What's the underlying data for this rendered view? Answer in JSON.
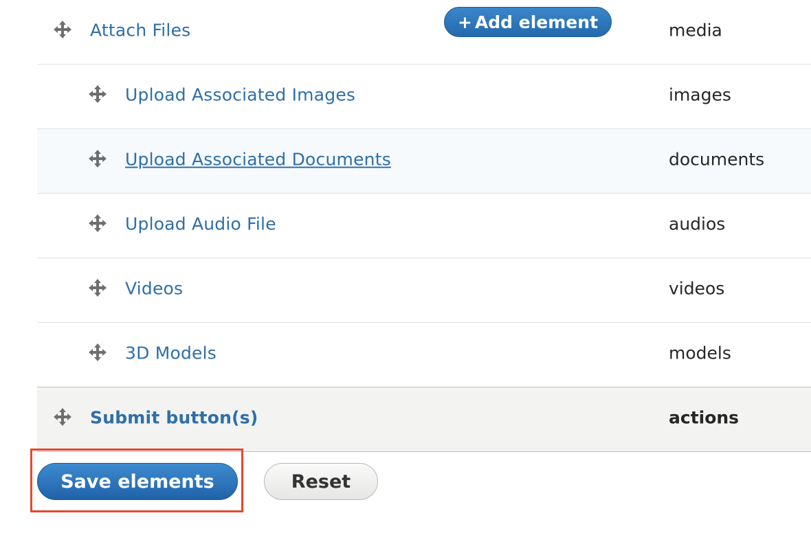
{
  "rows": [
    {
      "title": "Attach Files",
      "key": "media",
      "indent": 0
    },
    {
      "title": "Upload Associated Images",
      "key": "images",
      "indent": 1
    },
    {
      "title": "Upload Associated Documents",
      "key": "documents",
      "indent": 1
    },
    {
      "title": "Upload Audio File",
      "key": "audios",
      "indent": 1
    },
    {
      "title": "Videos",
      "key": "videos",
      "indent": 1
    },
    {
      "title": "3D Models",
      "key": "models",
      "indent": 1
    },
    {
      "title": "Submit button(s)",
      "key": "actions",
      "indent": 0
    }
  ],
  "add_element": {
    "plus": "+",
    "label": "Add element"
  },
  "buttons": {
    "save": "Save elements",
    "reset": "Reset"
  },
  "colors": {
    "link": "#2e6fa8",
    "primary": "#2369ad",
    "highlight": "#e5472d"
  },
  "icons": {
    "drag": "drag-handle-icon",
    "plus": "plus-icon"
  }
}
